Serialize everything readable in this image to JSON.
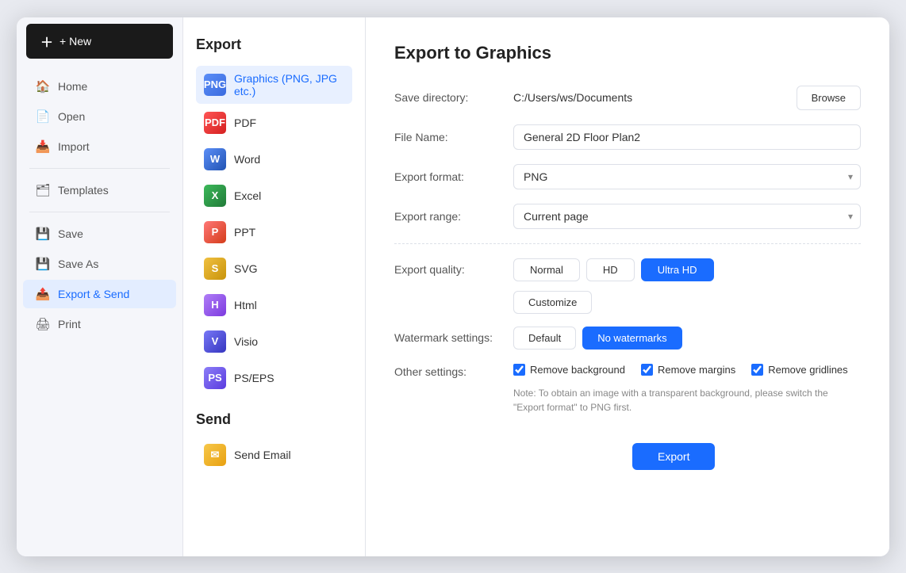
{
  "app": {
    "new_button": "+ New"
  },
  "sidebar": {
    "items": [
      {
        "id": "home",
        "label": "Home",
        "icon": "🏠"
      },
      {
        "id": "open",
        "label": "Open",
        "icon": "📄"
      },
      {
        "id": "import",
        "label": "Import",
        "icon": "📥"
      },
      {
        "id": "templates",
        "label": "Templates",
        "icon": "🗂"
      },
      {
        "id": "save",
        "label": "Save",
        "icon": "💾"
      },
      {
        "id": "save-as",
        "label": "Save As",
        "icon": "💾"
      },
      {
        "id": "export-send",
        "label": "Export & Send",
        "icon": "📤",
        "active": true
      },
      {
        "id": "print",
        "label": "Print",
        "icon": "🖨"
      }
    ]
  },
  "middle": {
    "export_title": "Export",
    "send_title": "Send",
    "export_items": [
      {
        "id": "graphics",
        "label": "Graphics (PNG, JPG etc.)",
        "iconClass": "icon-png",
        "iconText": "PNG",
        "active": true
      },
      {
        "id": "pdf",
        "label": "PDF",
        "iconClass": "icon-pdf",
        "iconText": "PDF"
      },
      {
        "id": "word",
        "label": "Word",
        "iconClass": "icon-word",
        "iconText": "W"
      },
      {
        "id": "excel",
        "label": "Excel",
        "iconClass": "icon-excel",
        "iconText": "X"
      },
      {
        "id": "ppt",
        "label": "PPT",
        "iconClass": "icon-ppt",
        "iconText": "P"
      },
      {
        "id": "svg",
        "label": "SVG",
        "iconClass": "icon-svg",
        "iconText": "S"
      },
      {
        "id": "html",
        "label": "Html",
        "iconClass": "icon-html",
        "iconText": "H"
      },
      {
        "id": "visio",
        "label": "Visio",
        "iconClass": "icon-visio",
        "iconText": "V"
      },
      {
        "id": "pseps",
        "label": "PS/EPS",
        "iconClass": "icon-pseps",
        "iconText": "PS"
      }
    ],
    "send_items": [
      {
        "id": "email",
        "label": "Send Email",
        "iconClass": "icon-email",
        "iconText": "✉"
      }
    ]
  },
  "content": {
    "title": "Export to Graphics",
    "save_directory_label": "Save directory:",
    "save_directory_value": "C:/Users/ws/Documents",
    "browse_label": "Browse",
    "file_name_label": "File Name:",
    "file_name_value": "General 2D Floor Plan2",
    "export_format_label": "Export format:",
    "export_format_value": "PNG",
    "export_range_label": "Export range:",
    "export_range_value": "Current page",
    "export_quality_label": "Export quality:",
    "quality_options": [
      {
        "id": "normal",
        "label": "Normal",
        "selected": false
      },
      {
        "id": "hd",
        "label": "HD",
        "selected": false
      },
      {
        "id": "ultra-hd",
        "label": "Ultra HD",
        "selected": true
      }
    ],
    "customize_label": "Customize",
    "watermark_label": "Watermark settings:",
    "watermark_options": [
      {
        "id": "default",
        "label": "Default",
        "selected": false
      },
      {
        "id": "no-watermarks",
        "label": "No watermarks",
        "selected": true
      }
    ],
    "other_settings_label": "Other settings:",
    "checkboxes": [
      {
        "id": "remove-bg",
        "label": "Remove background",
        "checked": true
      },
      {
        "id": "remove-margins",
        "label": "Remove margins",
        "checked": true
      },
      {
        "id": "remove-gridlines",
        "label": "Remove gridlines",
        "checked": true
      }
    ],
    "note": "Note: To obtain an image with a transparent background, please switch the \"Export format\" to PNG first.",
    "export_button": "Export"
  }
}
